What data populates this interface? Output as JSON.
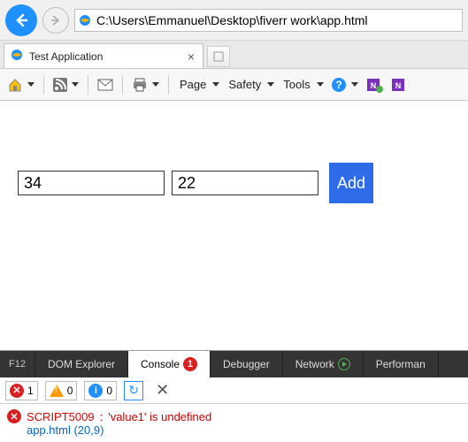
{
  "nav": {
    "url": "C:\\Users\\Emmanuel\\Desktop\\fiverr work\\app.html"
  },
  "tab": {
    "title": "Test Application"
  },
  "toolbar": {
    "menu_page": "Page",
    "menu_safety": "Safety",
    "menu_tools": "Tools"
  },
  "form": {
    "input1": "34",
    "input2": "22",
    "add_label": "Add"
  },
  "devtools": {
    "f12": "F12",
    "tabs": {
      "dom": "DOM Explorer",
      "console": "Console",
      "debugger": "Debugger",
      "network": "Network",
      "performance": "Performan"
    },
    "console_badge": "1",
    "counters": {
      "errors": "1",
      "warnings": "0",
      "info": "0"
    },
    "error": {
      "code": "SCRIPT5009",
      "colon": ": ",
      "message": "'value1' is undefined",
      "location": "app.html (20,9)"
    }
  }
}
